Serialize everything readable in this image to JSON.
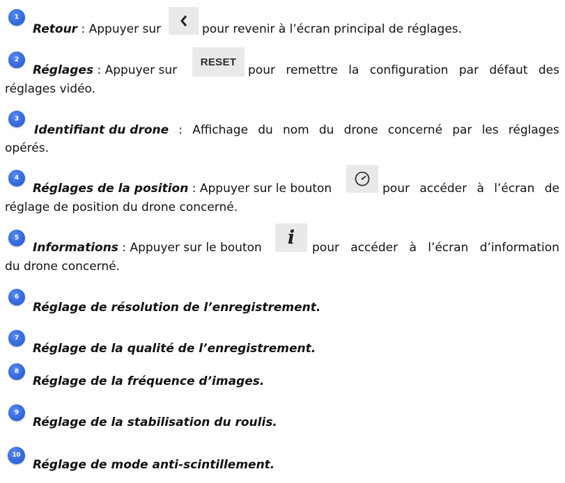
{
  "items": [
    {
      "number": "1",
      "title": "Retour",
      "text_before": " : Appuyer sur ",
      "text_after": " pour revenir à l’écran principal de réglages.",
      "icon": "chevron-left-icon"
    },
    {
      "number": "2",
      "title": "Réglages",
      "text_before": " : Appuyer sur",
      "text_after_line1_words": [
        "pour",
        "remettre",
        "la",
        "configuration",
        "par",
        "défaut",
        "des"
      ],
      "text_line2": "réglages vidéo.",
      "button_label": "RESET"
    },
    {
      "number": "3",
      "title": "Identifiant du drone",
      "text_after_line1_words": [
        ":",
        "Affichage",
        "du",
        "nom",
        "du",
        "drone",
        "concerné",
        "par",
        "les",
        "réglages"
      ],
      "text_line2": "opérés."
    },
    {
      "number": "4",
      "title": "Réglages de la position",
      "text_before": " : Appuyer sur le bouton ",
      "text_after_line1_words": [
        "pour",
        "accéder",
        "à",
        "l’écran",
        "de"
      ],
      "text_line2": "réglage de position du drone concerné.",
      "icon": "gauge-icon"
    },
    {
      "number": "5",
      "title": "Informations",
      "text_before": " : Appuyer sur le bouton ",
      "text_after_line1_words": [
        "pour",
        "accéder",
        "à",
        "l’écran",
        "d’information"
      ],
      "text_line2": "du drone concerné.",
      "icon": "info-icon",
      "icon_glyph": "i"
    },
    {
      "number": "6",
      "title": "Réglage de résolution de l’enregistrement."
    },
    {
      "number": "7",
      "title": "Réglage de la qualité de l’enregistrement."
    },
    {
      "number": "8",
      "title": "Réglage de la fréquence d’images."
    },
    {
      "number": "9",
      "title": "Réglage de la stabilisation du roulis."
    },
    {
      "number": "10",
      "title": "Réglage de mode anti-scintillement."
    }
  ],
  "colors": {
    "badge": "#3a6fe0",
    "text": "#111111",
    "button_bg": "#e9e9e9"
  }
}
